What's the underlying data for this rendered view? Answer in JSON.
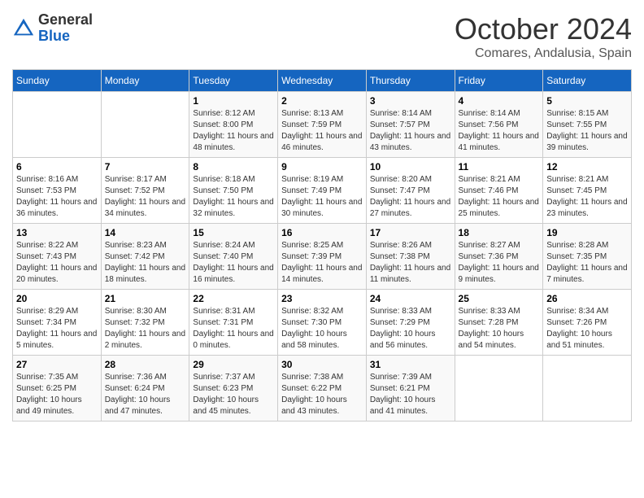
{
  "header": {
    "logo_general": "General",
    "logo_blue": "Blue",
    "month": "October 2024",
    "location": "Comares, Andalusia, Spain"
  },
  "weekdays": [
    "Sunday",
    "Monday",
    "Tuesday",
    "Wednesday",
    "Thursday",
    "Friday",
    "Saturday"
  ],
  "weeks": [
    [
      {
        "day": "",
        "info": ""
      },
      {
        "day": "",
        "info": ""
      },
      {
        "day": "1",
        "info": "Sunrise: 8:12 AM\nSunset: 8:00 PM\nDaylight: 11 hours and 48 minutes."
      },
      {
        "day": "2",
        "info": "Sunrise: 8:13 AM\nSunset: 7:59 PM\nDaylight: 11 hours and 46 minutes."
      },
      {
        "day": "3",
        "info": "Sunrise: 8:14 AM\nSunset: 7:57 PM\nDaylight: 11 hours and 43 minutes."
      },
      {
        "day": "4",
        "info": "Sunrise: 8:14 AM\nSunset: 7:56 PM\nDaylight: 11 hours and 41 minutes."
      },
      {
        "day": "5",
        "info": "Sunrise: 8:15 AM\nSunset: 7:55 PM\nDaylight: 11 hours and 39 minutes."
      }
    ],
    [
      {
        "day": "6",
        "info": "Sunrise: 8:16 AM\nSunset: 7:53 PM\nDaylight: 11 hours and 36 minutes."
      },
      {
        "day": "7",
        "info": "Sunrise: 8:17 AM\nSunset: 7:52 PM\nDaylight: 11 hours and 34 minutes."
      },
      {
        "day": "8",
        "info": "Sunrise: 8:18 AM\nSunset: 7:50 PM\nDaylight: 11 hours and 32 minutes."
      },
      {
        "day": "9",
        "info": "Sunrise: 8:19 AM\nSunset: 7:49 PM\nDaylight: 11 hours and 30 minutes."
      },
      {
        "day": "10",
        "info": "Sunrise: 8:20 AM\nSunset: 7:47 PM\nDaylight: 11 hours and 27 minutes."
      },
      {
        "day": "11",
        "info": "Sunrise: 8:21 AM\nSunset: 7:46 PM\nDaylight: 11 hours and 25 minutes."
      },
      {
        "day": "12",
        "info": "Sunrise: 8:21 AM\nSunset: 7:45 PM\nDaylight: 11 hours and 23 minutes."
      }
    ],
    [
      {
        "day": "13",
        "info": "Sunrise: 8:22 AM\nSunset: 7:43 PM\nDaylight: 11 hours and 20 minutes."
      },
      {
        "day": "14",
        "info": "Sunrise: 8:23 AM\nSunset: 7:42 PM\nDaylight: 11 hours and 18 minutes."
      },
      {
        "day": "15",
        "info": "Sunrise: 8:24 AM\nSunset: 7:40 PM\nDaylight: 11 hours and 16 minutes."
      },
      {
        "day": "16",
        "info": "Sunrise: 8:25 AM\nSunset: 7:39 PM\nDaylight: 11 hours and 14 minutes."
      },
      {
        "day": "17",
        "info": "Sunrise: 8:26 AM\nSunset: 7:38 PM\nDaylight: 11 hours and 11 minutes."
      },
      {
        "day": "18",
        "info": "Sunrise: 8:27 AM\nSunset: 7:36 PM\nDaylight: 11 hours and 9 minutes."
      },
      {
        "day": "19",
        "info": "Sunrise: 8:28 AM\nSunset: 7:35 PM\nDaylight: 11 hours and 7 minutes."
      }
    ],
    [
      {
        "day": "20",
        "info": "Sunrise: 8:29 AM\nSunset: 7:34 PM\nDaylight: 11 hours and 5 minutes."
      },
      {
        "day": "21",
        "info": "Sunrise: 8:30 AM\nSunset: 7:32 PM\nDaylight: 11 hours and 2 minutes."
      },
      {
        "day": "22",
        "info": "Sunrise: 8:31 AM\nSunset: 7:31 PM\nDaylight: 11 hours and 0 minutes."
      },
      {
        "day": "23",
        "info": "Sunrise: 8:32 AM\nSunset: 7:30 PM\nDaylight: 10 hours and 58 minutes."
      },
      {
        "day": "24",
        "info": "Sunrise: 8:33 AM\nSunset: 7:29 PM\nDaylight: 10 hours and 56 minutes."
      },
      {
        "day": "25",
        "info": "Sunrise: 8:33 AM\nSunset: 7:28 PM\nDaylight: 10 hours and 54 minutes."
      },
      {
        "day": "26",
        "info": "Sunrise: 8:34 AM\nSunset: 7:26 PM\nDaylight: 10 hours and 51 minutes."
      }
    ],
    [
      {
        "day": "27",
        "info": "Sunrise: 7:35 AM\nSunset: 6:25 PM\nDaylight: 10 hours and 49 minutes."
      },
      {
        "day": "28",
        "info": "Sunrise: 7:36 AM\nSunset: 6:24 PM\nDaylight: 10 hours and 47 minutes."
      },
      {
        "day": "29",
        "info": "Sunrise: 7:37 AM\nSunset: 6:23 PM\nDaylight: 10 hours and 45 minutes."
      },
      {
        "day": "30",
        "info": "Sunrise: 7:38 AM\nSunset: 6:22 PM\nDaylight: 10 hours and 43 minutes."
      },
      {
        "day": "31",
        "info": "Sunrise: 7:39 AM\nSunset: 6:21 PM\nDaylight: 10 hours and 41 minutes."
      },
      {
        "day": "",
        "info": ""
      },
      {
        "day": "",
        "info": ""
      }
    ]
  ]
}
